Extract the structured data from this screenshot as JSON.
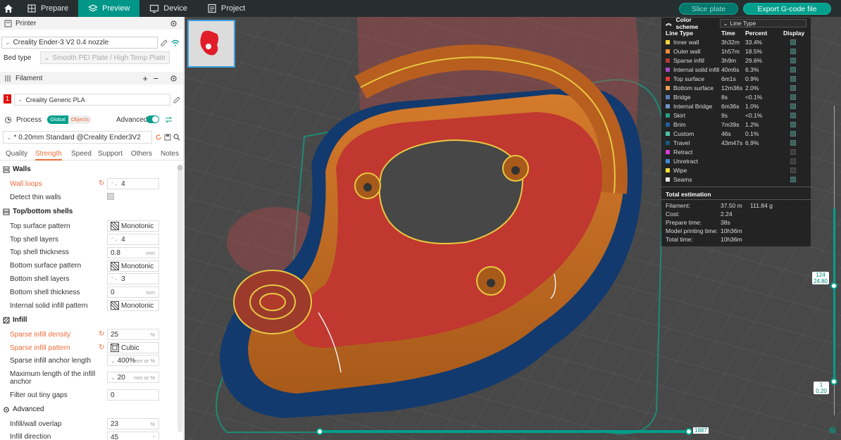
{
  "tabs": [
    "Prepare",
    "Preview",
    "Device",
    "Project"
  ],
  "actions": {
    "slice": "Slice plate",
    "export": "Export G-code file"
  },
  "printer": {
    "header": "Printer",
    "name": "Creality Ender-3 V2 0.4 nozzle",
    "bed_label": "Bed type",
    "bed_value": "Smooth PEI Plate / High Temp Plate"
  },
  "filament": {
    "header": "Filament",
    "index": "1",
    "name": "Creality Generic PLA"
  },
  "process": {
    "header": "Process",
    "global": "Global",
    "objects": "Objects",
    "advanced": "Advanced",
    "preset": "* 0.20mm Standard @Creality Ender3V2"
  },
  "process_tabs": [
    "Quality",
    "Strength",
    "Speed",
    "Support",
    "Others",
    "Notes"
  ],
  "settings": {
    "walls": "Walls",
    "wall_loops": "Wall loops",
    "wall_loops_v": "4",
    "detect_thin": "Detect thin walls",
    "topbottom": "Top/bottom shells",
    "top_pattern": "Top surface pattern",
    "top_pattern_v": "Monotonic",
    "top_layers": "Top shell layers",
    "top_layers_v": "4",
    "top_thick": "Top shell thickness",
    "top_thick_v": "0.8",
    "mm": "mm",
    "bot_pattern": "Bottom surface pattern",
    "bot_pattern_v": "Monotonic",
    "bot_layers": "Bottom shell layers",
    "bot_layers_v": "3",
    "bot_thick": "Bottom shell thickness",
    "bot_thick_v": "0",
    "isi_pattern": "Internal solid infill pattern",
    "isi_pattern_v": "Monotonic",
    "infill": "Infill",
    "density": "Sparse infill density",
    "density_v": "25",
    "pct": "%",
    "sparse_pattern": "Sparse infill pattern",
    "sparse_pattern_v": "Cubic",
    "anchor": "Sparse infill anchor length",
    "anchor_v": "400%",
    "mmor": "mm or %",
    "anchor_max": "Maximum length of the infill",
    "anchor_max2": "anchor",
    "anchor_max_v": "20",
    "tiny_gaps": "Filter out tiny gaps",
    "tiny_gaps_v": "0",
    "advanced": "Advanced",
    "overlap": "Infill/wall overlap",
    "overlap_v": "23",
    "direction": "Infill direction",
    "direction_v": "45",
    "deg": "°"
  },
  "legend": {
    "title": "Color scheme",
    "scheme": "Line Type",
    "cols": [
      "Line Type",
      "Time",
      "Percent",
      "Display"
    ],
    "rows": [
      {
        "name": "Inner wall",
        "time": "3h32m",
        "pct": "33.4%",
        "color": "#f5d43b",
        "on": true
      },
      {
        "name": "Outer wall",
        "time": "1h57m",
        "pct": "18.5%",
        "color": "#f08a3c",
        "on": true
      },
      {
        "name": "Sparse infill",
        "time": "3h9m",
        "pct": "29.6%",
        "color": "#b63a3a",
        "on": true
      },
      {
        "name": "Internal solid infill",
        "time": "40m6s",
        "pct": "6.3%",
        "color": "#a64ac9",
        "on": true
      },
      {
        "name": "Top surface",
        "time": "6m1s",
        "pct": "0.9%",
        "color": "#e03a3a",
        "on": true
      },
      {
        "name": "Bottom surface",
        "time": "12m36s",
        "pct": "2.0%",
        "color": "#f0a050",
        "on": true
      },
      {
        "name": "Bridge",
        "time": "8s",
        "pct": "<0.1%",
        "color": "#5a7fb5",
        "on": true
      },
      {
        "name": "Internal Bridge",
        "time": "6m36s",
        "pct": "1.0%",
        "color": "#7095c8",
        "on": true
      },
      {
        "name": "Skirt",
        "time": "9s",
        "pct": "<0.1%",
        "color": "#2aa08a",
        "on": true
      },
      {
        "name": "Brim",
        "time": "7m39s",
        "pct": "1.2%",
        "color": "#1f5fa0",
        "on": true
      },
      {
        "name": "Custom",
        "time": "46s",
        "pct": "0.1%",
        "color": "#4fc3a7",
        "on": true
      },
      {
        "name": "Travel",
        "time": "43m47s",
        "pct": "6.9%",
        "color": "#1a5a7a",
        "on": true
      },
      {
        "name": "Retract",
        "time": "",
        "pct": "",
        "color": "#d63ad6",
        "on": false
      },
      {
        "name": "Unretract",
        "time": "",
        "pct": "",
        "color": "#3a8ad6",
        "on": false
      },
      {
        "name": "Wipe",
        "time": "",
        "pct": "",
        "color": "#f5e23a",
        "on": false
      },
      {
        "name": "Seams",
        "time": "",
        "pct": "",
        "color": "#e6e6e6",
        "on": true
      }
    ],
    "total_title": "Total estimation",
    "totals": [
      {
        "k": "Filament:",
        "v": "37.50 m",
        "v2": "111.84 g"
      },
      {
        "k": "Cost:",
        "v": "2.24",
        "v2": ""
      },
      {
        "k": "Prepare time:",
        "v": "38s",
        "v2": ""
      },
      {
        "k": "Model printing time:",
        "v": "10h36m",
        "v2": ""
      },
      {
        "k": "Total time:",
        "v": "10h36m",
        "v2": ""
      }
    ]
  },
  "slider": {
    "top_layer": "124",
    "top_height": "24.80",
    "bottom_layer": "1",
    "bottom_height": "0.20",
    "horizontal": "1887"
  },
  "colors": {
    "accent": "#00a08c",
    "modified": "#ef6b3b"
  }
}
